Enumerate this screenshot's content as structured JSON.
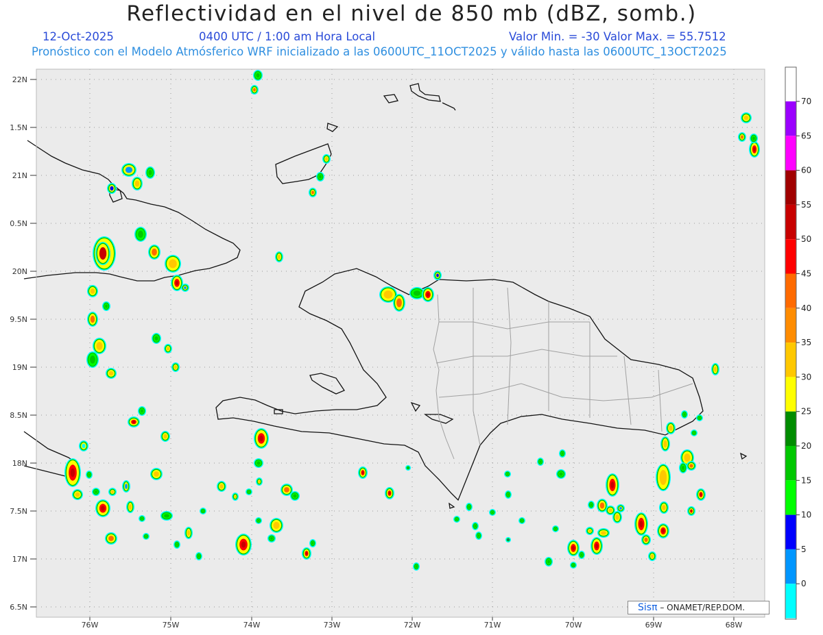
{
  "header": {
    "title": "Reflectividad en el nivel de 850 mb (dBZ, somb.)",
    "date": "12-Oct-2025",
    "time": "0400 UTC / 1:00 am Hora Local",
    "minmax": "Valor Min. = -30  Valor Max. = 55.7512",
    "forecast": "Pronóstico con el Modelo Atmósferico WRF inicializado a las 0600UTC_11OCT2025 y válido hasta las  0600UTC_13OCT2025"
  },
  "axes": {
    "lat_labels": [
      "22N",
      "1.5N",
      "21N",
      "0.5N",
      "20N",
      "9.5N",
      "19N",
      "8.5N",
      "18N",
      "7.5N",
      "17N",
      "6.5N"
    ],
    "lon_labels": [
      "76W",
      "75W",
      "74W",
      "73W",
      "72W",
      "71W",
      "70W",
      "69W",
      "68W"
    ]
  },
  "colorbar": {
    "labels": [
      "70",
      "65",
      "60",
      "55",
      "50",
      "45",
      "40",
      "35",
      "30",
      "25",
      "20",
      "15",
      "10",
      "5",
      "0"
    ],
    "colors": [
      "#9b00ff",
      "#ff00ff",
      "#a00000",
      "#c80000",
      "#ff0000",
      "#ff6a00",
      "#ff8c00",
      "#ffc800",
      "#ffff00",
      "#008c00",
      "#00c800",
      "#00ff00",
      "#0000ff",
      "#0096ff",
      "#00ffff",
      "#e6e6e6"
    ]
  },
  "credit": {
    "logo": "Sisπ",
    "text": "– ONAMET/REP.DOM."
  }
}
